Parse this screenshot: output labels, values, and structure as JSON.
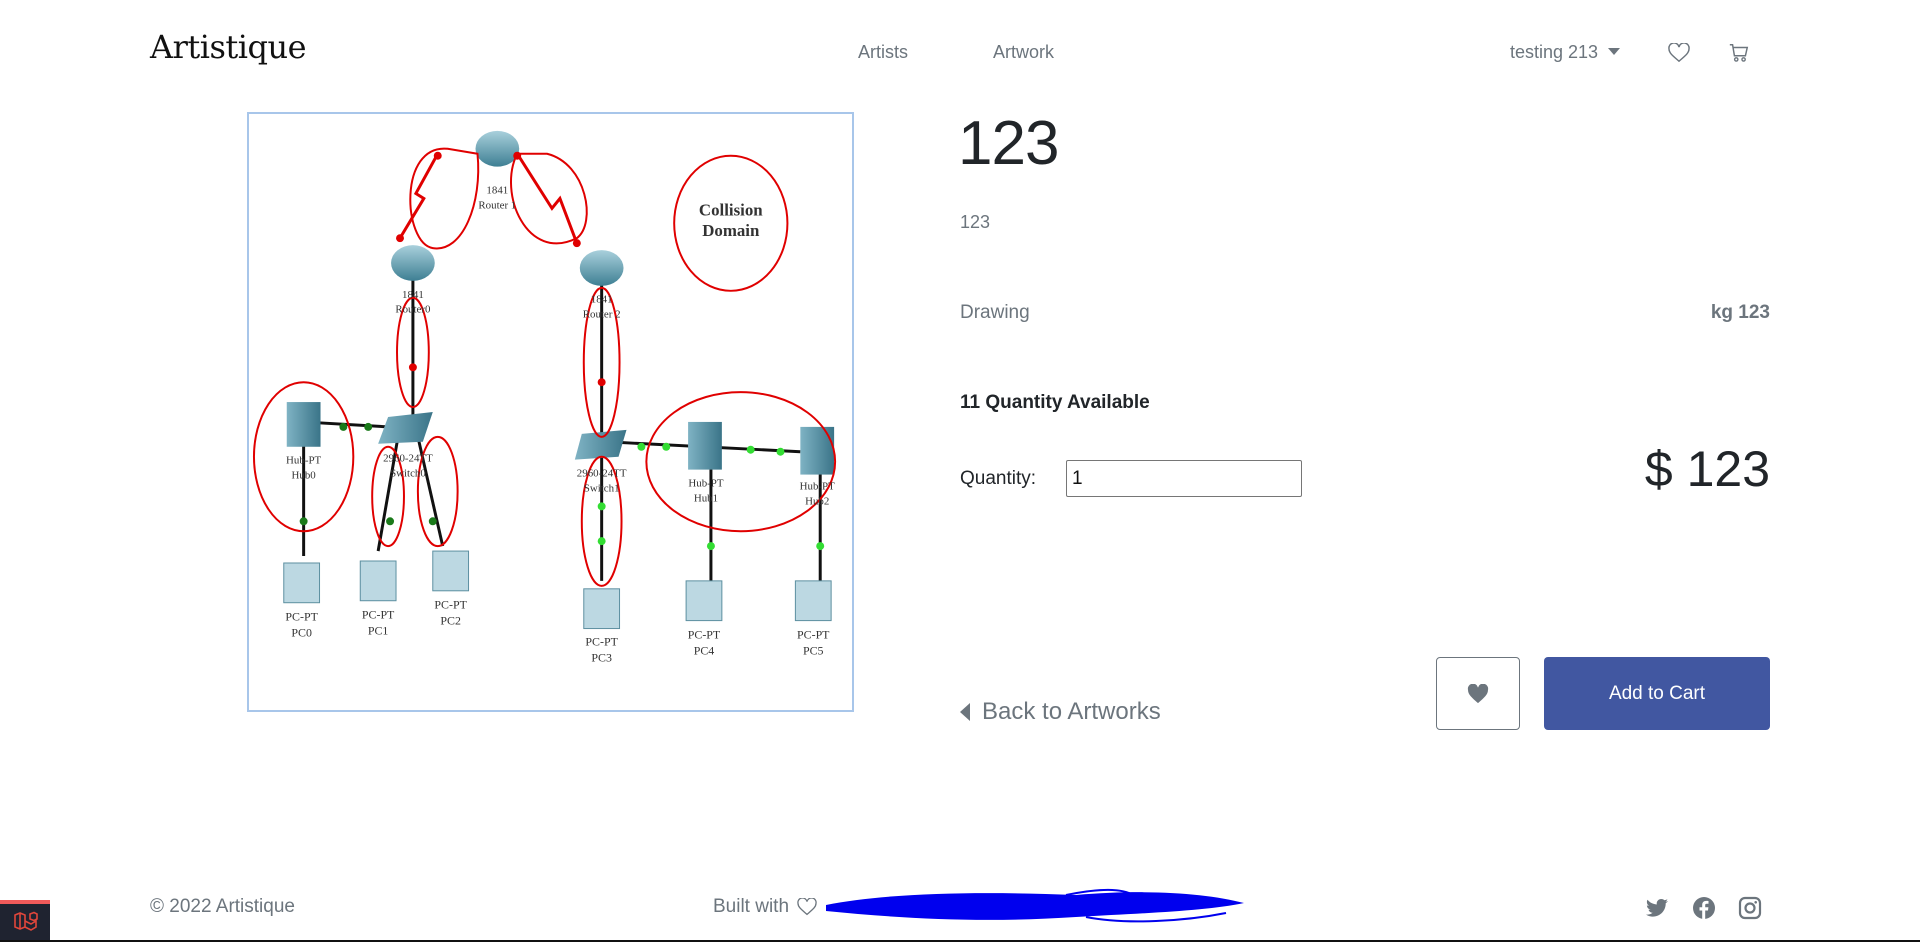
{
  "header": {
    "brand": "Artistique",
    "nav": [
      {
        "label": "Artists"
      },
      {
        "label": "Artwork"
      }
    ],
    "user_menu": {
      "label": "testing 213",
      "icon": "caret-down-icon"
    },
    "wishlist_icon": "heart-outline-icon",
    "cart_icon": "cart-icon"
  },
  "artwork": {
    "image_alt": "Network diagram with collision domains",
    "diagram": {
      "legend": [
        "Collision",
        "Domain"
      ],
      "routers": [
        {
          "model": "1841",
          "name": "Router 1"
        },
        {
          "model": "1841",
          "name": "Router0"
        },
        {
          "model": "1841",
          "name": "Router 2"
        }
      ],
      "switches": [
        {
          "model": "2960-24TT",
          "name": "Switch0"
        },
        {
          "model": "2960-24TT",
          "name": "Switch1"
        }
      ],
      "hubs": [
        {
          "model": "Hub-PT",
          "name": "Hub0"
        },
        {
          "model": "Hub-PT",
          "name": "Hub1"
        },
        {
          "model": "Hub-PT",
          "name": "Hub2"
        }
      ],
      "pcs": [
        {
          "model": "PC-PT",
          "name": "PC0"
        },
        {
          "model": "PC-PT",
          "name": "PC1"
        },
        {
          "model": "PC-PT",
          "name": "PC2"
        },
        {
          "model": "PC-PT",
          "name": "PC3"
        },
        {
          "model": "PC-PT",
          "name": "PC4"
        },
        {
          "model": "PC-PT",
          "name": "PC5"
        }
      ]
    }
  },
  "product": {
    "title": "123",
    "subtitle": "123",
    "category": "Drawing",
    "weight": "kg 123",
    "quantity_available": "11 Quantity Available",
    "quantity_label": "Quantity:",
    "quantity_value": "1",
    "price": "$ 123",
    "back_label": "Back to Artworks",
    "wishlist_button_icon": "heart-filled-icon",
    "add_to_cart_label": "Add to Cart"
  },
  "footer": {
    "copyright": "© 2022 Artistique",
    "built_with": "Built with",
    "built_with_icon": "heart-outline-icon",
    "social": [
      "twitter-icon",
      "facebook-icon",
      "instagram-icon"
    ]
  },
  "colors": {
    "primary": "#4157a1",
    "muted": "#6c757d",
    "text": "#212529",
    "image_border": "#a8c6ea",
    "annotation_red": "#e00000",
    "redaction_blue": "#0000ee"
  }
}
